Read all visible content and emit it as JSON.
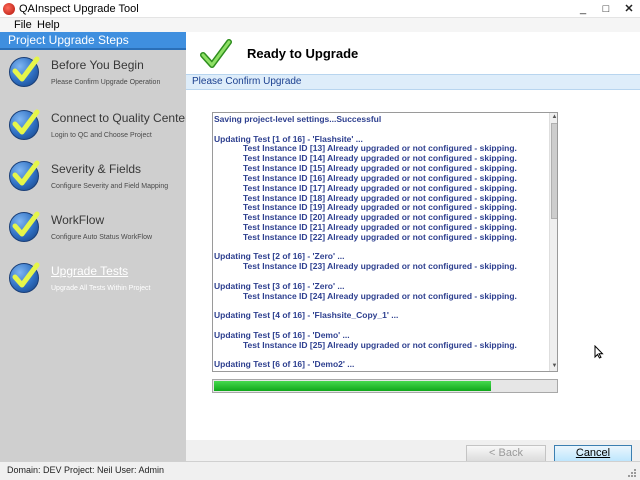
{
  "window": {
    "title": "QAInspect Upgrade Tool"
  },
  "titlebar_buttons": {
    "minimize": "_",
    "maximize": "□",
    "close": "✕"
  },
  "menu": [
    {
      "label": "File"
    },
    {
      "label": "Help"
    }
  ],
  "sidebar": {
    "header": "Project Upgrade Steps",
    "steps": [
      {
        "title": "Before You Begin",
        "subtitle": "Please Confirm Upgrade Operation",
        "active": false
      },
      {
        "title": "Connect to Quality Center",
        "subtitle": "Login to QC and Choose Project",
        "active": false
      },
      {
        "title": "Severity & Fields",
        "subtitle": "Configure Severity and Field Mapping",
        "active": false
      },
      {
        "title": "WorkFlow",
        "subtitle": "Configure Auto Status WorkFlow",
        "active": false
      },
      {
        "title": "Upgrade Tests",
        "subtitle": "Upgrade All Tests Within Project",
        "active": true
      }
    ]
  },
  "main": {
    "title": "Ready to Upgrade",
    "section_label": "Please Confirm Upgrade",
    "log_lines": [
      {
        "text": "Saving project-level settings...Successful",
        "indent": false
      },
      {
        "text": "",
        "indent": false
      },
      {
        "text": "Updating Test [1 of 16] - 'Flashsite' ...",
        "indent": false
      },
      {
        "text": "Test Instance ID [13] Already upgraded or not configured - skipping.",
        "indent": true
      },
      {
        "text": "Test Instance ID [14] Already upgraded or not configured - skipping.",
        "indent": true
      },
      {
        "text": "Test Instance ID [15] Already upgraded or not configured - skipping.",
        "indent": true
      },
      {
        "text": "Test Instance ID [16] Already upgraded or not configured - skipping.",
        "indent": true
      },
      {
        "text": "Test Instance ID [17] Already upgraded or not configured - skipping.",
        "indent": true
      },
      {
        "text": "Test Instance ID [18] Already upgraded or not configured - skipping.",
        "indent": true
      },
      {
        "text": "Test Instance ID [19] Already upgraded or not configured - skipping.",
        "indent": true
      },
      {
        "text": "Test Instance ID [20] Already upgraded or not configured - skipping.",
        "indent": true
      },
      {
        "text": "Test Instance ID [21] Already upgraded or not configured - skipping.",
        "indent": true
      },
      {
        "text": "Test Instance ID [22] Already upgraded or not configured - skipping.",
        "indent": true
      },
      {
        "text": "",
        "indent": false
      },
      {
        "text": "Updating Test [2 of 16] - 'Zero' ...",
        "indent": false
      },
      {
        "text": "Test Instance ID [23] Already upgraded or not configured - skipping.",
        "indent": true
      },
      {
        "text": "",
        "indent": false
      },
      {
        "text": "Updating Test [3 of 16] - 'Zero' ...",
        "indent": false
      },
      {
        "text": "Test Instance ID [24] Already upgraded or not configured - skipping.",
        "indent": true
      },
      {
        "text": "",
        "indent": false
      },
      {
        "text": "Updating Test [4 of 16] - 'Flashsite_Copy_1' ...",
        "indent": false
      },
      {
        "text": "",
        "indent": false
      },
      {
        "text": "Updating Test [5 of 16] - 'Demo' ...",
        "indent": false
      },
      {
        "text": "Test Instance ID [25] Already upgraded or not configured - skipping.",
        "indent": true
      },
      {
        "text": "",
        "indent": false
      },
      {
        "text": "Updating Test [6 of 16] - 'Demo2' ...",
        "indent": false
      }
    ],
    "progress_percent": 81
  },
  "footer": {
    "back_label": "< Back",
    "cancel_label": "Cancel"
  },
  "status": {
    "text": "Domain: DEV Project: Neil User: Admin"
  },
  "colors": {
    "steps_header": "#3f8fdf",
    "log_text": "#2d3f8f",
    "progress": "#1fba28",
    "sidebar_bg": "#cfcfcf"
  }
}
